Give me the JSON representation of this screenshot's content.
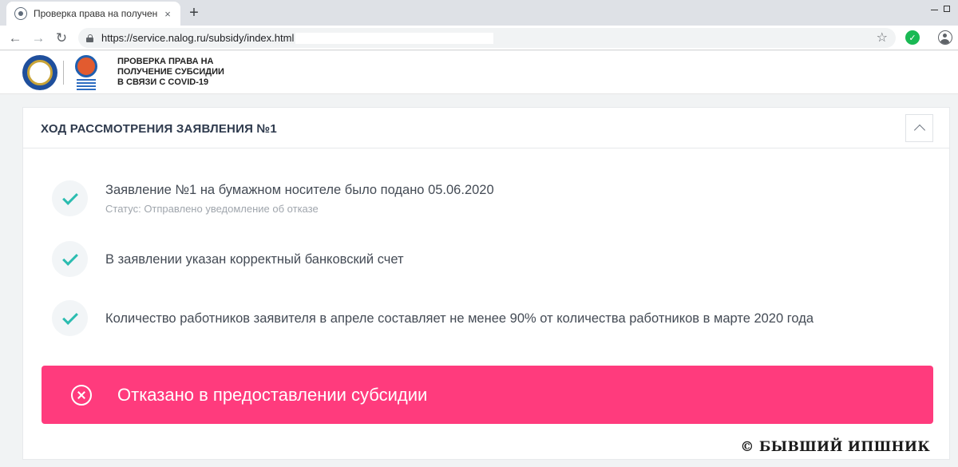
{
  "browser": {
    "tab_title": "Проверка права на получение",
    "tab_close": "×",
    "new_tab": "+",
    "url": "https://service.nalog.ru/subsidy/index.html",
    "back": "←",
    "forward": "→",
    "reload": "↻",
    "star": "☆",
    "extension_glyph": "✓"
  },
  "header": {
    "title_lines": [
      "ПРОВЕРКА ПРАВА НА",
      "ПОЛУЧЕНИЕ СУБСИДИИ",
      "В СВЯЗИ С COVID-19"
    ]
  },
  "card": {
    "title": "ХОД РАССМОТРЕНИЯ ЗАЯВЛЕНИЯ №1",
    "steps": [
      {
        "title": "Заявление №1 на бумажном носителе было подано 05.06.2020",
        "status": "Статус: Отправлено уведомление об отказе"
      },
      {
        "title": "В заявлении указан корректный банковский счет"
      },
      {
        "title": "Количество работников заявителя в апреле составляет не менее 90% от количества работников в марте 2020 года"
      }
    ],
    "rejection": "Отказано в предоставлении субсидии"
  },
  "watermark": "© БЫВШИЙ ИПШНИК",
  "colors": {
    "accent_check": "#2bbcb0",
    "rejection_bg": "#ff3b7d",
    "title_text": "#2e3a4d"
  }
}
